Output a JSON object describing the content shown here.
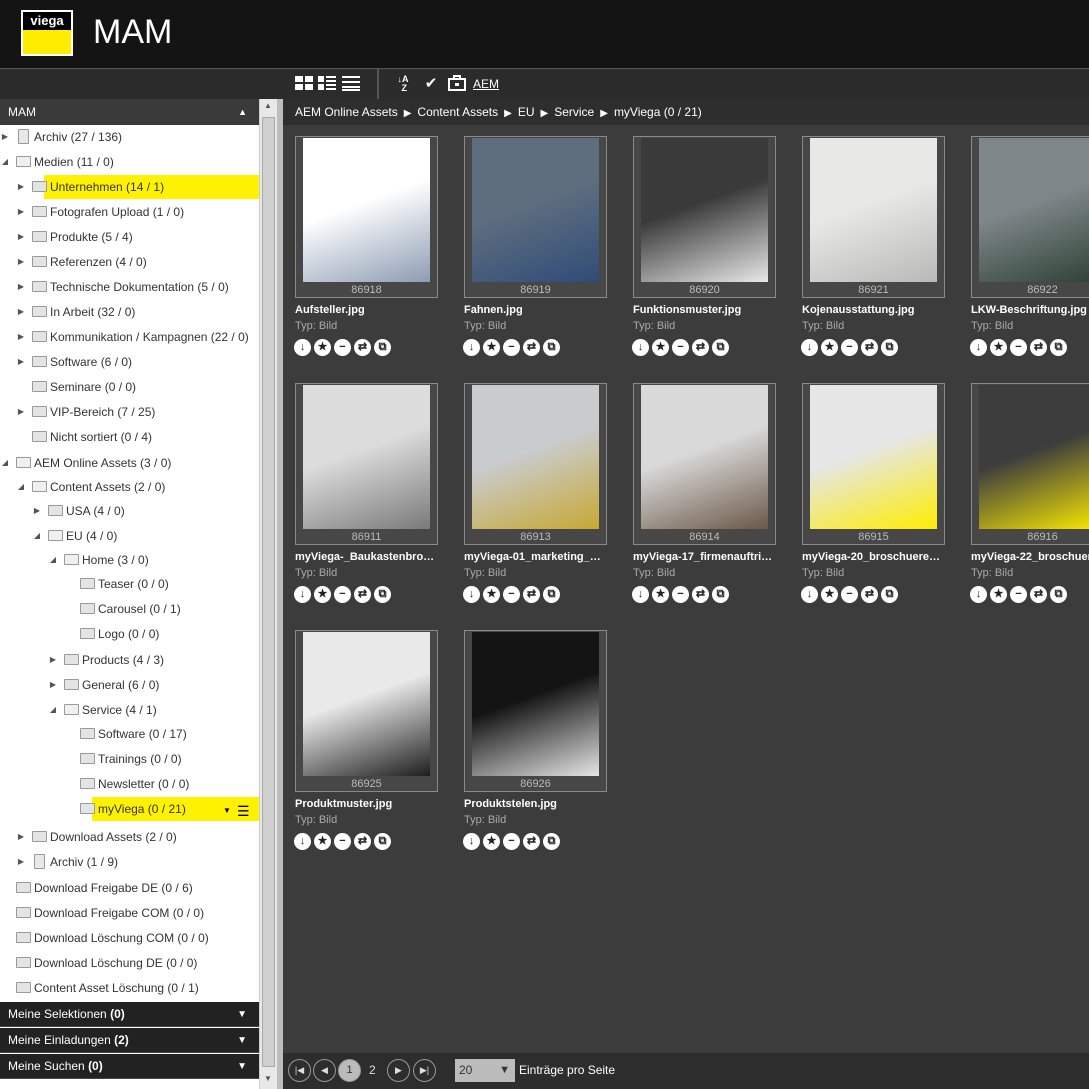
{
  "app": {
    "logo_text": "viega",
    "title": "MAM",
    "brand_color": "#ffed00"
  },
  "toolbar": {
    "aem_label": "AEM",
    "icons": [
      "grid-view-icon",
      "detail-view-icon",
      "list-view-icon",
      "sort-az-icon",
      "check-icon",
      "briefcase-icon"
    ]
  },
  "sidebar": {
    "title": "MAM",
    "tree": [
      {
        "label": "Archiv (27 / 136)",
        "level": 0,
        "toggle": "collapsed",
        "icon": "trash"
      },
      {
        "label": "Medien (11 / 0)",
        "level": 0,
        "toggle": "expanded",
        "icon": "folder"
      },
      {
        "label": "Unternehmen (14 / 1)",
        "level": 1,
        "toggle": "collapsed",
        "icon": "folder",
        "highlight": true
      },
      {
        "label": "Fotografen Upload (1 / 0)",
        "level": 1,
        "toggle": "collapsed",
        "icon": "folder"
      },
      {
        "label": "Produkte (5 / 4)",
        "level": 1,
        "toggle": "collapsed",
        "icon": "folder"
      },
      {
        "label": "Referenzen (4 / 0)",
        "level": 1,
        "toggle": "collapsed",
        "icon": "folder"
      },
      {
        "label": "Technische Dokumentation (5 / 0)",
        "level": 1,
        "toggle": "collapsed",
        "icon": "folder"
      },
      {
        "label": "In Arbeit (32 / 0)",
        "level": 1,
        "toggle": "collapsed",
        "icon": "folder"
      },
      {
        "label": "Kommunikation / Kampagnen (22 / 0)",
        "level": 1,
        "toggle": "collapsed",
        "icon": "folder"
      },
      {
        "label": "Software (6 / 0)",
        "level": 1,
        "toggle": "collapsed",
        "icon": "folder"
      },
      {
        "label": "Seminare (0 / 0)",
        "level": 1,
        "toggle": "none",
        "icon": "folder"
      },
      {
        "label": "VIP-Bereich (7 / 25)",
        "level": 1,
        "toggle": "collapsed",
        "icon": "folder"
      },
      {
        "label": "Nicht sortiert (0 / 4)",
        "level": 1,
        "toggle": "none",
        "icon": "folder"
      },
      {
        "label": "AEM Online Assets (3 / 0)",
        "level": 0,
        "toggle": "expanded",
        "icon": "folder"
      },
      {
        "label": "Content Assets (2 / 0)",
        "level": 1,
        "toggle": "expanded",
        "icon": "folder"
      },
      {
        "label": "USA (4 / 0)",
        "level": 2,
        "toggle": "collapsed",
        "icon": "folder"
      },
      {
        "label": "EU (4 / 0)",
        "level": 2,
        "toggle": "expanded",
        "icon": "folder"
      },
      {
        "label": "Home (3 / 0)",
        "level": 3,
        "toggle": "expanded",
        "icon": "folder"
      },
      {
        "label": "Teaser (0 / 0)",
        "level": 4,
        "toggle": "none",
        "icon": "folder"
      },
      {
        "label": "Carousel (0 / 1)",
        "level": 4,
        "toggle": "none",
        "icon": "folder"
      },
      {
        "label": "Logo (0 / 0)",
        "level": 4,
        "toggle": "none",
        "icon": "folder"
      },
      {
        "label": "Products (4 / 3)",
        "level": 3,
        "toggle": "collapsed",
        "icon": "folder"
      },
      {
        "label": "General (6 / 0)",
        "level": 3,
        "toggle": "collapsed",
        "icon": "folder"
      },
      {
        "label": "Service (4 / 1)",
        "level": 3,
        "toggle": "expanded",
        "icon": "folder"
      },
      {
        "label": "Software (0 / 17)",
        "level": 4,
        "toggle": "none",
        "icon": "folder"
      },
      {
        "label": "Trainings (0 / 0)",
        "level": 4,
        "toggle": "none",
        "icon": "folder"
      },
      {
        "label": "Newsletter (0 / 0)",
        "level": 4,
        "toggle": "none",
        "icon": "folder"
      },
      {
        "label": "myViega (0 / 21)",
        "level": 4,
        "toggle": "none",
        "icon": "folder",
        "highlight": true,
        "selected": true
      },
      {
        "label": "Download Assets (2 / 0)",
        "level": 1,
        "toggle": "collapsed",
        "icon": "folder"
      },
      {
        "label": "Archiv (1 / 9)",
        "level": 1,
        "toggle": "collapsed",
        "icon": "trash"
      },
      {
        "label": "Download Freigabe DE (0 / 6)",
        "level": 0,
        "toggle": "none",
        "icon": "folder"
      },
      {
        "label": "Download Freigabe COM (0 / 0)",
        "level": 0,
        "toggle": "none",
        "icon": "folder"
      },
      {
        "label": "Download Löschung COM (0 / 0)",
        "level": 0,
        "toggle": "none",
        "icon": "folder"
      },
      {
        "label": "Download Löschung DE (0 / 0)",
        "level": 0,
        "toggle": "none",
        "icon": "folder"
      },
      {
        "label": "Content Asset Löschung (0 / 1)",
        "level": 0,
        "toggle": "none",
        "icon": "folder"
      }
    ],
    "panels": [
      {
        "label": "Meine Selektionen",
        "count": "(0)"
      },
      {
        "label": "Meine Einladungen",
        "count": "(2)"
      },
      {
        "label": "Meine Suchen",
        "count": "(0)"
      }
    ]
  },
  "breadcrumb": [
    "AEM Online Assets",
    "Content Assets",
    "EU",
    "Service",
    "myViega (0 / 21)"
  ],
  "assets": [
    {
      "id": "86918",
      "name": "Aufsteller.jpg",
      "type": "Typ: Bild",
      "bg": "#ffffff",
      "fg": "#8d9cb3"
    },
    {
      "id": "86919",
      "name": "Fahnen.jpg",
      "type": "Typ: Bild",
      "bg": "#5f6e7f",
      "fg": "#2f4c78"
    },
    {
      "id": "86920",
      "name": "Funktionsmuster.jpg",
      "type": "Typ: Bild",
      "bg": "#3a3a3a",
      "fg": "#e8e8e8"
    },
    {
      "id": "86921",
      "name": "Kojenausstattung.jpg",
      "type": "Typ: Bild",
      "bg": "#e8e8e6",
      "fg": "#b9b9b9"
    },
    {
      "id": "86922",
      "name": "LKW-Beschriftung.jpg",
      "type": "Typ: Bild",
      "bg": "#7d8688",
      "fg": "#2d3f33"
    },
    {
      "id": "86911",
      "name": "myViega-_Baukastenbro…",
      "type": "Typ: Bild",
      "bg": "#dcdcdc",
      "fg": "#7a7a7a"
    },
    {
      "id": "86913",
      "name": "myViega-01_marketing_…",
      "type": "Typ: Bild",
      "bg": "#c9cccf",
      "fg": "#c8a832"
    },
    {
      "id": "86914",
      "name": "myViega-17_firmenauftri…",
      "type": "Typ: Bild",
      "bg": "#d9d9d9",
      "fg": "#6b5848"
    },
    {
      "id": "86915",
      "name": "myViega-20_broschuere…",
      "type": "Typ: Bild",
      "bg": "#e6e6e6",
      "fg": "#ffed00"
    },
    {
      "id": "86916",
      "name": "myViega-22_broschuere…",
      "type": "Typ: Bild",
      "bg": "#3d3d3d",
      "fg": "#ffed00"
    },
    {
      "id": "86925",
      "name": "Produktmuster.jpg",
      "type": "Typ: Bild",
      "bg": "#e9e9e9",
      "fg": "#1e1e1e"
    },
    {
      "id": "86926",
      "name": "Produktstelen.jpg",
      "type": "Typ: Bild",
      "bg": "#141414",
      "fg": "#e6e6e6"
    }
  ],
  "actions": [
    "download-icon",
    "star-icon",
    "remove-icon",
    "share-icon",
    "copy-icon"
  ],
  "pager": {
    "pages": [
      "1",
      "2"
    ],
    "current": "1",
    "per_page": "20",
    "per_page_label": "Einträge pro Seite"
  }
}
